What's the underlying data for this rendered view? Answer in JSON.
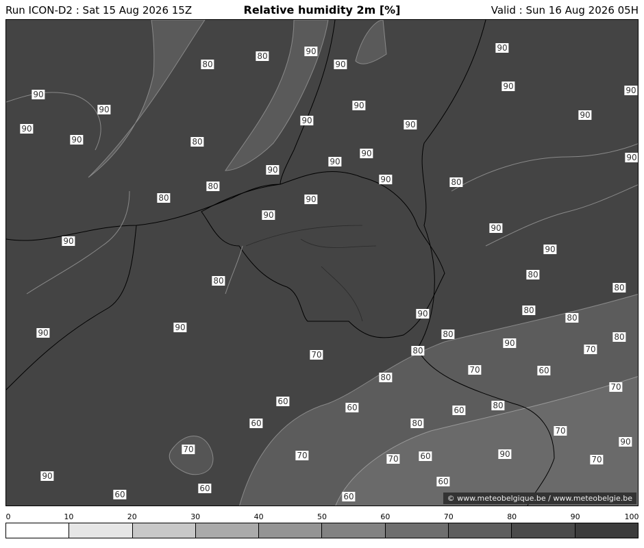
{
  "header": {
    "run": "Run ICON-D2 : Sat 15 Aug 2026 15Z",
    "title": "Relative humidity 2m [%]",
    "valid": "Valid : Sun 16 Aug 2026 05H"
  },
  "credit": "© www.meteobelgique.be / www.meteobelgie.be",
  "legend": {
    "ticks": [
      "0",
      "10",
      "20",
      "30",
      "40",
      "50",
      "60",
      "70",
      "80",
      "90",
      "100"
    ],
    "colors": [
      "#ffffff",
      "#e6e6e6",
      "#c8c8c8",
      "#aaaaaa",
      "#949494",
      "#828282",
      "#6e6e6e",
      "#5e5e5e",
      "#4a4a4a",
      "#3c3c3c"
    ]
  },
  "contour_labels": [
    {
      "text": "80"
    },
    {
      "text": "80"
    },
    {
      "text": "90"
    },
    {
      "text": "90"
    },
    {
      "text": "90"
    },
    {
      "text": "90"
    },
    {
      "text": "90"
    },
    {
      "text": "90"
    },
    {
      "text": "90"
    },
    {
      "text": "80"
    },
    {
      "text": "90"
    },
    {
      "text": "90"
    },
    {
      "text": "90"
    },
    {
      "text": "90"
    },
    {
      "text": "90"
    },
    {
      "text": "90"
    },
    {
      "text": "90"
    },
    {
      "text": "90"
    },
    {
      "text": "90"
    },
    {
      "text": "80"
    },
    {
      "text": "90"
    },
    {
      "text": "80"
    },
    {
      "text": "80"
    },
    {
      "text": "90"
    },
    {
      "text": "90"
    },
    {
      "text": "90"
    },
    {
      "text": "90"
    },
    {
      "text": "90"
    },
    {
      "text": "80"
    },
    {
      "text": "90"
    },
    {
      "text": "80"
    },
    {
      "text": "80"
    },
    {
      "text": "80"
    },
    {
      "text": "80"
    },
    {
      "text": "90"
    },
    {
      "text": "90"
    },
    {
      "text": "90"
    },
    {
      "text": "80"
    },
    {
      "text": "80"
    },
    {
      "text": "70"
    },
    {
      "text": "80"
    },
    {
      "text": "70"
    },
    {
      "text": "70"
    },
    {
      "text": "90"
    },
    {
      "text": "60"
    },
    {
      "text": "80"
    },
    {
      "text": "70"
    },
    {
      "text": "60"
    },
    {
      "text": "60"
    },
    {
      "text": "80"
    },
    {
      "text": "60"
    },
    {
      "text": "60"
    },
    {
      "text": "80"
    },
    {
      "text": "70"
    },
    {
      "text": "70"
    },
    {
      "text": "60"
    },
    {
      "text": "70"
    },
    {
      "text": "70"
    },
    {
      "text": "90"
    },
    {
      "text": "90"
    },
    {
      "text": "90"
    },
    {
      "text": "60"
    },
    {
      "text": "60"
    },
    {
      "text": "60"
    },
    {
      "text": "70"
    },
    {
      "text": "60"
    }
  ]
}
